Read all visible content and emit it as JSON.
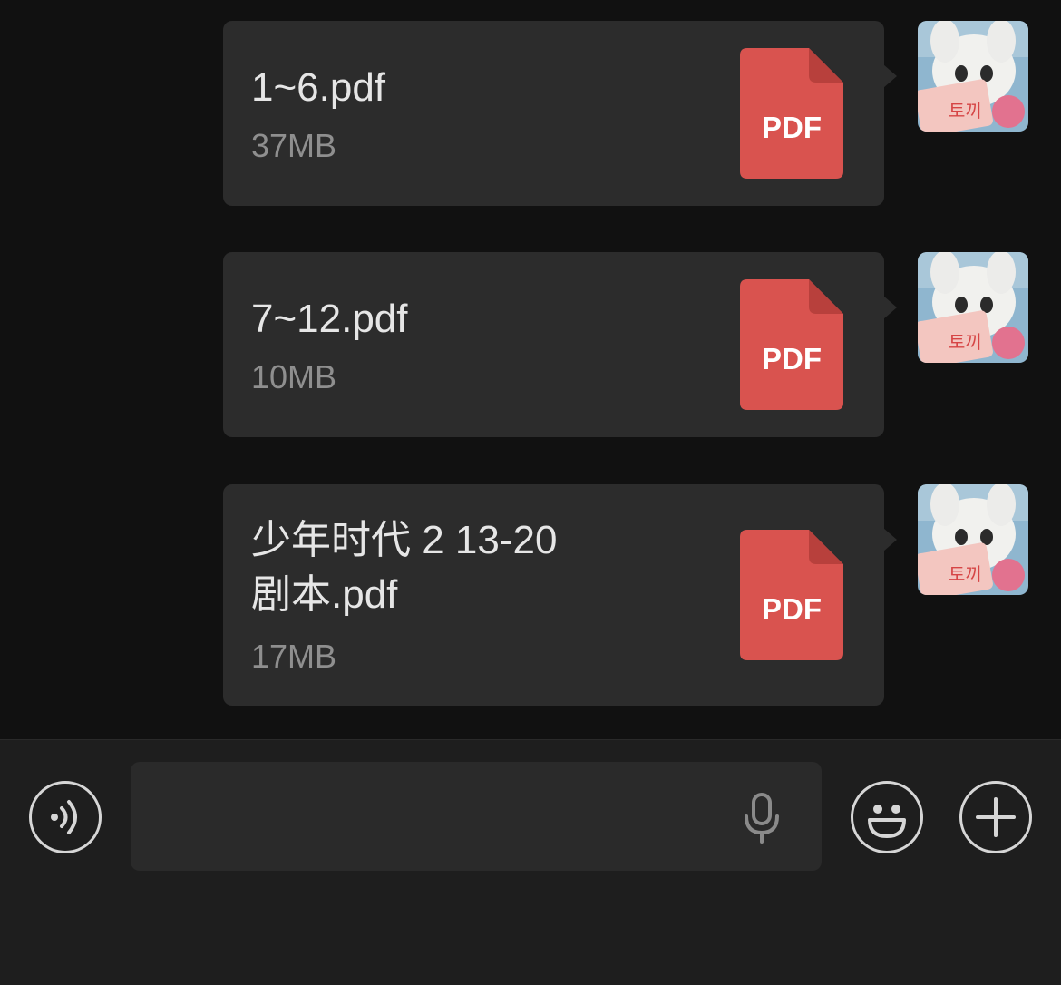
{
  "messages": [
    {
      "file_name": "1~6.pdf",
      "file_size": "37MB",
      "file_type_label": "PDF",
      "sender": "self"
    },
    {
      "file_name": "7~12.pdf",
      "file_size": "10MB",
      "file_type_label": "PDF",
      "sender": "self"
    },
    {
      "file_name": "少年时代 2 13-20\n剧本.pdf",
      "file_size": "17MB",
      "file_type_label": "PDF",
      "sender": "self"
    }
  ],
  "avatar": {
    "text": "토끼"
  },
  "input_bar": {
    "placeholder": "",
    "value": "",
    "icons": [
      "voice-mode-icon",
      "microphone-icon",
      "emoji-icon",
      "plus-icon"
    ]
  },
  "colors": {
    "background": "#111111",
    "bubble": "#2c2c2c",
    "pdf_red": "#d9534f",
    "input_bar": "#1e1e1e"
  }
}
